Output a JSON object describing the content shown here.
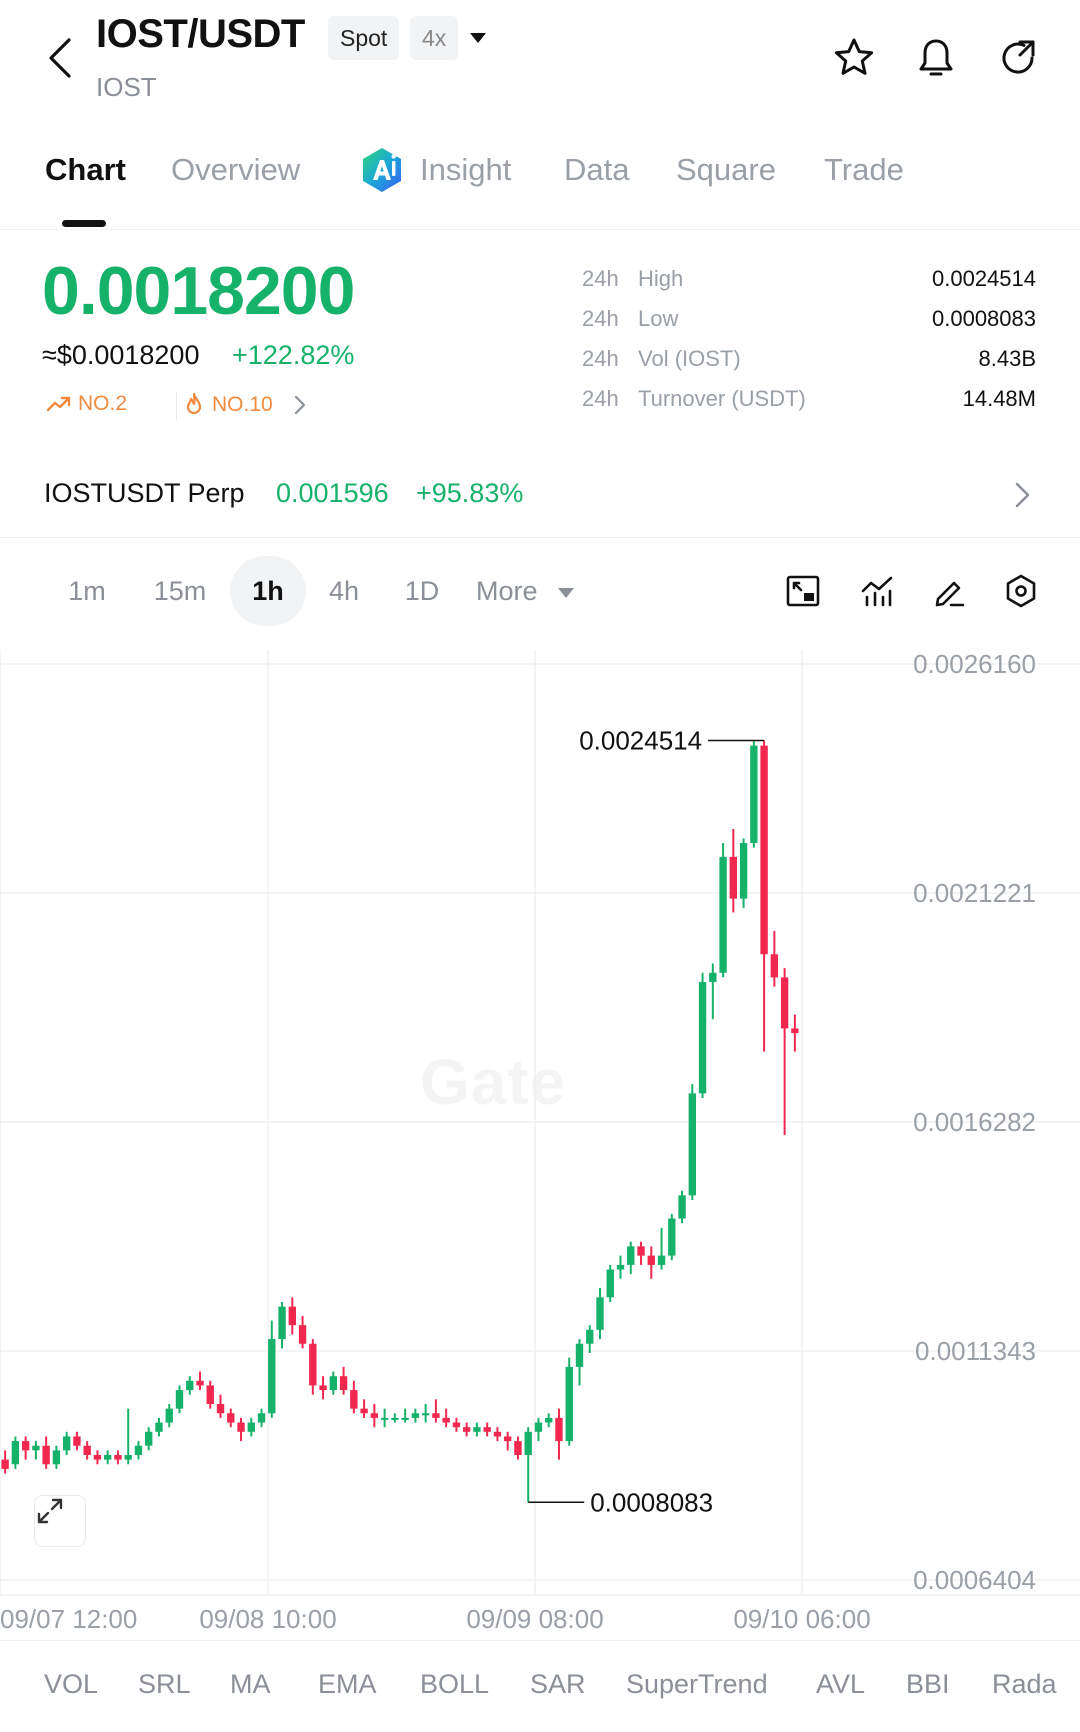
{
  "header": {
    "pair": "IOST/USDT",
    "base": "IOST",
    "market_badge": "Spot",
    "leverage_badge": "4x",
    "icons": [
      "back-icon",
      "star-icon",
      "bell-icon",
      "refresh-icon"
    ]
  },
  "tabs": [
    {
      "label": "Chart",
      "active": true
    },
    {
      "label": "Overview"
    },
    {
      "label": "Insight",
      "icon": "ai-logo-icon"
    },
    {
      "label": "Data"
    },
    {
      "label": "Square"
    },
    {
      "label": "Trade"
    }
  ],
  "price": {
    "last": "0.0018200",
    "usd": "≈$0.0018200",
    "change": "+122.82%",
    "rank_trending": "NO.2",
    "rank_hot": "NO.10"
  },
  "stats": [
    {
      "period": "24h",
      "label": "High",
      "value": "0.0024514"
    },
    {
      "period": "24h",
      "label": "Low",
      "value": "0.0008083"
    },
    {
      "period": "24h",
      "label": "Vol (IOST)",
      "value": "8.43B"
    },
    {
      "period": "24h",
      "label": "Turnover (USDT)",
      "value": "14.48M"
    }
  ],
  "perp": {
    "name": "IOSTUSDT Perp",
    "price": "0.001596",
    "change": "+95.83%"
  },
  "timeframes": [
    "1m",
    "15m",
    "1h",
    "4h",
    "1D",
    "More"
  ],
  "active_timeframe": "1h",
  "colors": {
    "up": "#17b26a",
    "down": "#f0284f",
    "text": "#111111",
    "muted": "#8a8f98",
    "grid": "#f0f0f2"
  },
  "chart": {
    "watermark": "Gate",
    "high_label": "0.0024514",
    "low_label": "0.0008083",
    "y_ticks": [
      "0.0026160",
      "0.0021221",
      "0.0016282",
      "0.0011343",
      "0.0006404"
    ],
    "x_ticks": [
      "09/07 12:00",
      "09/08 10:00",
      "09/09 08:00",
      "09/10 06:00"
    ]
  },
  "chart_data": {
    "type": "candlestick",
    "interval": "1h",
    "ylim": [
      0.0006404,
      0.002616
    ],
    "candles": [
      [
        0.0009,
        0.00092,
        0.00087,
        0.00088
      ],
      [
        0.00089,
        0.00095,
        0.00088,
        0.00094
      ],
      [
        0.00094,
        0.00095,
        0.0009,
        0.00092
      ],
      [
        0.00092,
        0.00094,
        0.0009,
        0.00093
      ],
      [
        0.00093,
        0.00095,
        0.00088,
        0.00089
      ],
      [
        0.00089,
        0.00093,
        0.00088,
        0.00092
      ],
      [
        0.00092,
        0.00096,
        0.00091,
        0.00095
      ],
      [
        0.00095,
        0.00096,
        0.00092,
        0.00093
      ],
      [
        0.00093,
        0.00094,
        0.0009,
        0.00091
      ],
      [
        0.00091,
        0.00092,
        0.00089,
        0.0009
      ],
      [
        0.0009,
        0.00092,
        0.00089,
        0.00091
      ],
      [
        0.00091,
        0.00092,
        0.00089,
        0.0009
      ],
      [
        0.0009,
        0.00101,
        0.00089,
        0.00091
      ],
      [
        0.00091,
        0.00094,
        0.0009,
        0.00093
      ],
      [
        0.00093,
        0.00097,
        0.00092,
        0.00096
      ],
      [
        0.00096,
        0.00099,
        0.00095,
        0.00098
      ],
      [
        0.00098,
        0.00102,
        0.00097,
        0.00101
      ],
      [
        0.00101,
        0.00106,
        0.001,
        0.00105
      ],
      [
        0.00105,
        0.00108,
        0.00104,
        0.00107
      ],
      [
        0.00107,
        0.00109,
        0.00105,
        0.00106
      ],
      [
        0.00106,
        0.00107,
        0.00101,
        0.00102
      ],
      [
        0.00102,
        0.00104,
        0.00099,
        0.001
      ],
      [
        0.001,
        0.00101,
        0.00097,
        0.00098
      ],
      [
        0.00098,
        0.00099,
        0.00094,
        0.00096
      ],
      [
        0.00096,
        0.00099,
        0.00095,
        0.00098
      ],
      [
        0.00098,
        0.00101,
        0.00097,
        0.001
      ],
      [
        0.001,
        0.0012,
        0.00099,
        0.00116
      ],
      [
        0.00116,
        0.00124,
        0.00114,
        0.00123
      ],
      [
        0.00123,
        0.00125,
        0.00117,
        0.00119
      ],
      [
        0.00119,
        0.00121,
        0.00114,
        0.00115
      ],
      [
        0.00115,
        0.00116,
        0.00104,
        0.00106
      ],
      [
        0.00106,
        0.00108,
        0.00103,
        0.00105
      ],
      [
        0.00105,
        0.00109,
        0.00104,
        0.00108
      ],
      [
        0.00108,
        0.0011,
        0.00104,
        0.00105
      ],
      [
        0.00105,
        0.00107,
        0.001,
        0.00101
      ],
      [
        0.00101,
        0.00103,
        0.00099,
        0.001
      ],
      [
        0.001,
        0.00102,
        0.00097,
        0.00099
      ],
      [
        0.00099,
        0.00101,
        0.00097,
        0.00099
      ],
      [
        0.00099,
        0.001,
        0.00098,
        0.00099
      ],
      [
        0.00099,
        0.00101,
        0.00098,
        0.00099
      ],
      [
        0.00099,
        0.00101,
        0.00098,
        0.001
      ],
      [
        0.001,
        0.00102,
        0.00098,
        0.001
      ],
      [
        0.001,
        0.00103,
        0.00098,
        0.00099
      ],
      [
        0.00099,
        0.00101,
        0.00097,
        0.00098
      ],
      [
        0.00098,
        0.00099,
        0.00096,
        0.00097
      ],
      [
        0.00097,
        0.00098,
        0.00095,
        0.00096
      ],
      [
        0.00096,
        0.00098,
        0.00095,
        0.00097
      ],
      [
        0.00097,
        0.00098,
        0.00095,
        0.00096
      ],
      [
        0.00096,
        0.00097,
        0.00094,
        0.00095
      ],
      [
        0.00095,
        0.00096,
        0.00092,
        0.00094
      ],
      [
        0.00094,
        0.00095,
        0.0009,
        0.00091
      ],
      [
        0.00091,
        0.00097,
        0.000808,
        0.00096
      ],
      [
        0.00096,
        0.00099,
        0.00094,
        0.00098
      ],
      [
        0.00098,
        0.001,
        0.00097,
        0.00099
      ],
      [
        0.00099,
        0.00101,
        0.0009,
        0.00094
      ],
      [
        0.00094,
        0.00112,
        0.00093,
        0.0011
      ],
      [
        0.0011,
        0.00116,
        0.00106,
        0.00115
      ],
      [
        0.00115,
        0.00119,
        0.00113,
        0.00118
      ],
      [
        0.00118,
        0.00127,
        0.00116,
        0.00125
      ],
      [
        0.00125,
        0.00132,
        0.00124,
        0.00131
      ],
      [
        0.00131,
        0.00134,
        0.00129,
        0.00132
      ],
      [
        0.00132,
        0.00137,
        0.0013,
        0.00136
      ],
      [
        0.00136,
        0.00137,
        0.00132,
        0.00134
      ],
      [
        0.00134,
        0.00136,
        0.00129,
        0.00132
      ],
      [
        0.00132,
        0.0014,
        0.00131,
        0.00134
      ],
      [
        0.00134,
        0.00143,
        0.00133,
        0.00142
      ],
      [
        0.00142,
        0.00148,
        0.00141,
        0.00147
      ],
      [
        0.00147,
        0.00171,
        0.00146,
        0.00169
      ],
      [
        0.00169,
        0.00195,
        0.00168,
        0.00193
      ],
      [
        0.00193,
        0.00197,
        0.00185,
        0.00195
      ],
      [
        0.00195,
        0.00223,
        0.00194,
        0.0022
      ],
      [
        0.0022,
        0.00226,
        0.00208,
        0.00211
      ],
      [
        0.00211,
        0.00224,
        0.00209,
        0.00223
      ],
      [
        0.00223,
        0.00245,
        0.00222,
        0.00244
      ],
      [
        0.00244,
        0.002451,
        0.00178,
        0.00199
      ],
      [
        0.00199,
        0.00204,
        0.00192,
        0.00194
      ],
      [
        0.00194,
        0.00196,
        0.0016,
        0.00183
      ],
      [
        0.00183,
        0.00186,
        0.00178,
        0.00182
      ]
    ]
  },
  "indicators": [
    "VOL",
    "SRL",
    "MA",
    "EMA",
    "BOLL",
    "SAR",
    "SuperTrend",
    "AVL",
    "BBI",
    "Rada"
  ]
}
